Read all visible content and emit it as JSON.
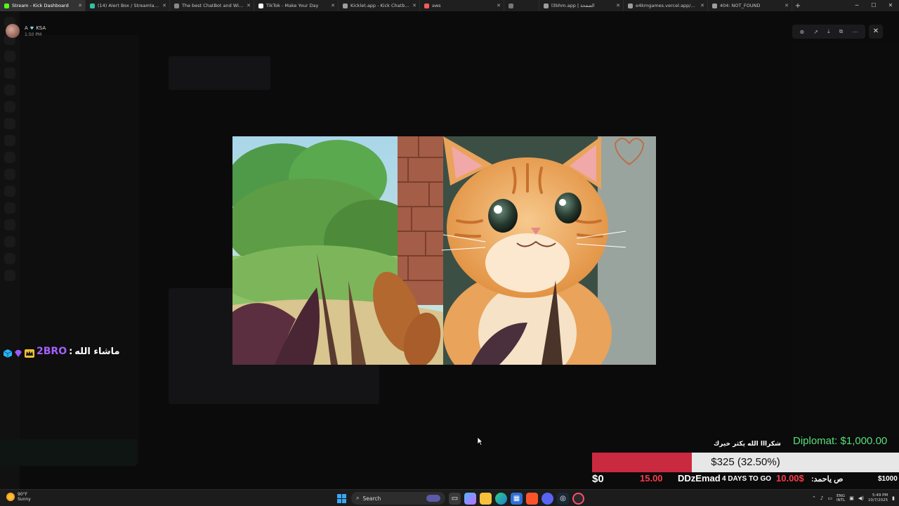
{
  "tabs": [
    {
      "label": "Stream - Kick Dashboard",
      "color": "#53fc18"
    },
    {
      "label": "(14) Alert Box / Streamlabs",
      "color": "#31c3a2"
    },
    {
      "label": "The best ChatBot and Widgets fo",
      "color": "#888888"
    },
    {
      "label": "TikTok - Make Your Day",
      "color": "#ffffff"
    },
    {
      "label": "Kicklet.app - Kick Chatbot and Cl",
      "color": "#9e9e9e"
    },
    {
      "label": "aws",
      "color": "#ff5a5a"
    },
    {
      "label": "",
      "color": "#777777"
    },
    {
      "label": "l3bhm.app | الصفحة",
      "color": "#9e9e9e"
    },
    {
      "label": "e4kmgames.vercel.app/games/b",
      "color": "#9e9e9e"
    },
    {
      "label": "404: NOT_FOUND",
      "color": "#9e9e9e"
    }
  ],
  "viewer": {
    "user_initial": "A",
    "user_tag": "KSA",
    "time": "1:50 PM",
    "tools": [
      "zoom-in",
      "share",
      "download",
      "open-external",
      "more"
    ]
  },
  "chat_overlay": {
    "username": "2BRO",
    "separator": ":",
    "message": "ماشاء الله"
  },
  "donation_goal": {
    "thanks_text": "شكرااا الله يكثر خيرك",
    "goal_title": "Diplomat: $1,000.00",
    "progress_text": "$325 (32.50%)",
    "progress_fraction": 0.325,
    "min_label": "$0",
    "amount_1": "15.00",
    "donor_name": "DDzEmad",
    "days_label": "4 DAYS TO GO",
    "amount_2": "10.00$",
    "arabic_label": "ص ياحمد:",
    "max_label": "$1000",
    "fill_color": "#c92a3f",
    "title_color": "#55e07a"
  },
  "taskbar": {
    "temperature": "90°F",
    "weather": "Sunny",
    "search_placeholder": "Search",
    "lang_line1": "ENG",
    "lang_line2": "INTL",
    "time": "5:49 PM",
    "date": "10/7/2025"
  }
}
